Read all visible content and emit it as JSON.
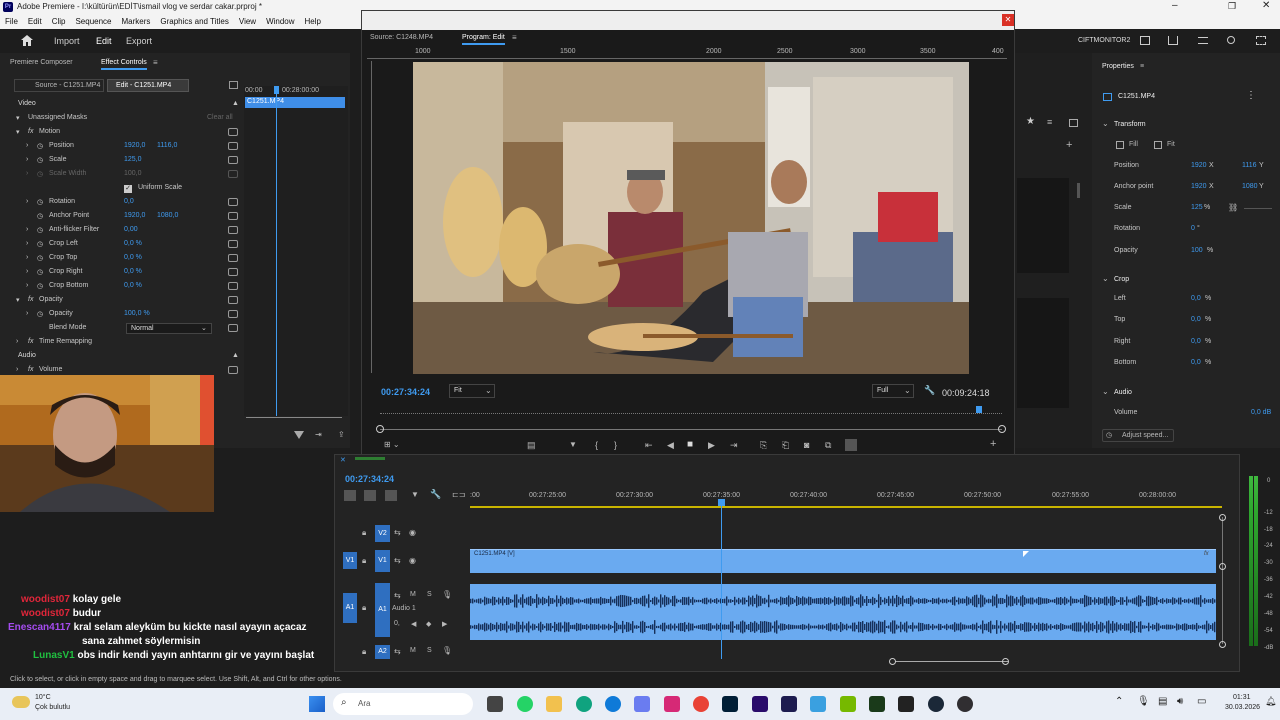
{
  "window": {
    "title": "Adobe Premiere - I:\\kültürün\\EDİT\\ismail vlog ve serdar cakar.prproj *"
  },
  "menu": [
    "File",
    "Edit",
    "Clip",
    "Sequence",
    "Markers",
    "Graphics and Titles",
    "View",
    "Window",
    "Help"
  ],
  "workspace": {
    "import": "Import",
    "edit": "Edit",
    "export": "Export",
    "monitor_name": "CIFTMONITOR2"
  },
  "effect_controls": {
    "tabs": [
      "Premiere Composer",
      "Effect Controls"
    ],
    "source_label": "Source - C1251.MP4",
    "seq_label": "Edit - C1251.MP4",
    "mini_time_start": "00:00",
    "mini_time_end": "00:28:00:00",
    "mini_clip": "C1251.MP4",
    "video_header": "Video",
    "unassigned_masks": "Unassigned Masks",
    "clear_all": "Clear all",
    "motion": "Motion",
    "position": {
      "label": "Position",
      "x": "1920,0",
      "y": "1116,0"
    },
    "scale": {
      "label": "Scale",
      "value": "125,0"
    },
    "scale_width": {
      "label": "Scale Width",
      "value": "100,0"
    },
    "uniform_scale": "Uniform Scale",
    "rotation": {
      "label": "Rotation",
      "value": "0,0"
    },
    "anchor": {
      "label": "Anchor Point",
      "x": "1920,0",
      "y": "1080,0"
    },
    "antiflicker": {
      "label": "Anti-flicker Filter",
      "value": "0,00"
    },
    "crop_left": {
      "label": "Crop Left",
      "value": "0,0 %"
    },
    "crop_top": {
      "label": "Crop Top",
      "value": "0,0 %"
    },
    "crop_right": {
      "label": "Crop Right",
      "value": "0,0 %"
    },
    "crop_bottom": {
      "label": "Crop Bottom",
      "value": "0,0 %"
    },
    "opacity_section": "Opacity",
    "opacity": {
      "label": "Opacity",
      "value": "100,0 %"
    },
    "blend": {
      "label": "Blend Mode",
      "value": "Normal"
    },
    "time_remap": "Time Remapping",
    "audio_header": "Audio",
    "volume": "Volume"
  },
  "monitor": {
    "source_tab": "Source: C1248.MP4",
    "program_tab": "Program: Edit",
    "ruler": [
      "1000",
      "1500",
      "2000",
      "2500",
      "3000",
      "3500",
      "400"
    ],
    "timecode": "00:27:34:24",
    "fit": "Fit",
    "full": "Full",
    "duration": "00:09:24:18",
    "playhead_fraction": 0.974
  },
  "properties": {
    "title": "Properties",
    "clip": "C1251.MP4",
    "transform": "Transform",
    "fill": "Fill",
    "fit": "Fit",
    "position": {
      "label": "Position",
      "x": "1920",
      "xu": "X",
      "y": "1116",
      "yu": "Y"
    },
    "anchor": {
      "label": "Anchor point",
      "x": "1920",
      "xu": "X",
      "y": "1080",
      "yu": "Y"
    },
    "scale": {
      "label": "Scale",
      "value": "125",
      "unit": "%"
    },
    "rotation": {
      "label": "Rotation",
      "value": "0",
      "unit": "°"
    },
    "opacity": {
      "label": "Opacity",
      "value": "100",
      "unit": "%"
    },
    "crop": "Crop",
    "crop_left": {
      "label": "Left",
      "value": "0,0",
      "unit": "%"
    },
    "crop_top": {
      "label": "Top",
      "value": "0,0",
      "unit": "%"
    },
    "crop_right": {
      "label": "Right",
      "value": "0,0",
      "unit": "%"
    },
    "crop_bottom": {
      "label": "Bottom",
      "value": "0,0",
      "unit": "%"
    },
    "audio": "Audio",
    "volume": {
      "label": "Volume",
      "value": "0,0 dB"
    },
    "adjust_speed": "Adjust speed..."
  },
  "chat": [
    {
      "user": "woodist07",
      "msg": "kolay gele",
      "color": "#e0263a"
    },
    {
      "user": "woodist07",
      "msg": "budur",
      "color": "#e0263a"
    },
    {
      "user": "Enescan4117",
      "msg": "kral selam aleyküm bu kickte nasıl ayayın açacaz",
      "color": "#a54cf0"
    },
    {
      "user": "",
      "msg": "sana zahmet söylermisin",
      "color": "#a54cf0"
    },
    {
      "user": "LunasV1",
      "msg": "obs indir kendi yayın anhtarını gir ve yayını başlat",
      "color": "#20c040"
    }
  ],
  "timeline": {
    "timecode": "00:27:34:24",
    "ruler": [
      ":00",
      "00:27:25:00",
      "00:27:30:00",
      "00:27:35:00",
      "00:27:40:00",
      "00:27:45:00",
      "00:27:50:00",
      "00:27:55:00",
      "00:28:00:00"
    ],
    "tracks": {
      "v2": "V2",
      "v1": "V1",
      "v1_left": "V1",
      "a1": "A1",
      "a1_name": "Audio 1",
      "a2": "A2",
      "a1_left": "A1",
      "a1_vol": "0,"
    },
    "clip_label": "C1251.MP4 [V]",
    "clip_fx": "fx",
    "meter_scale": [
      "0",
      "-12",
      "-18",
      "-24",
      "-30",
      "-36",
      "-42",
      "-48",
      "-54",
      "-dB"
    ]
  },
  "status": {
    "hint": "Click to select, or click in empty space and drag to marquee select. Use Shift, Alt, and Ctrl for other options."
  },
  "taskbar": {
    "weather_temp": "10°C",
    "weather_desc": "Çok bulutlu",
    "search": "Ara",
    "time": "01:31",
    "date": "30.03.2026"
  },
  "colors": {
    "accent_blue": "#3f9bf0",
    "clip_blue": "#6aaaf0",
    "panel": "#232323"
  }
}
